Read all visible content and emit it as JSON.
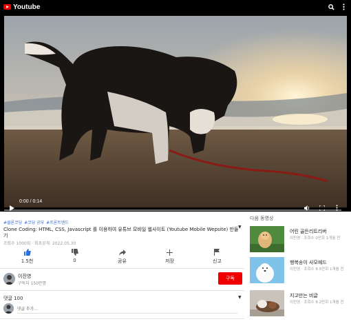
{
  "header": {
    "logo_text": "Youtube",
    "icons": [
      "search-icon",
      "more-vertical-icon"
    ]
  },
  "player": {
    "time": "0:00 / 0:14",
    "progress": 0,
    "controls": [
      "play-icon",
      "volume-icon",
      "fullscreen-icon",
      "more-vertical-icon"
    ]
  },
  "video": {
    "hashtags": [
      "#클론코딩",
      "#코딩 공부",
      "#프론트엔드"
    ],
    "title": "Clone Coding: HTML, CSS, Javascript 를 이용하여 유튜브 모바일 웹사이트 (Youtube Mobile Wepsite) 만들기",
    "meta": "조회수 1000회 · 최초공개: 2022.05.30"
  },
  "actions": [
    {
      "icon": "thumbs-up-icon",
      "label": "1.5천"
    },
    {
      "icon": "thumbs-down-icon",
      "label": "0"
    },
    {
      "icon": "share-icon",
      "label": "공유"
    },
    {
      "icon": "plus-icon",
      "label": "저장"
    },
    {
      "icon": "flag-icon",
      "label": "신고"
    }
  ],
  "channel": {
    "name": "이진영",
    "subscribers": "구독자 150만명",
    "subscribe_label": "구독"
  },
  "comments": {
    "header": "댓글 100",
    "placeholder": "댓글 추가..."
  },
  "sidebar": {
    "heading": "다음 동영상",
    "items": [
      {
        "title": "어린 골든리트리버",
        "meta": "이진영 · 조회수 0만회 1개월 전"
      },
      {
        "title": "행복송이 사모예드",
        "meta": "이진영 · 조회수 8.5만회 1개월 전"
      },
      {
        "title": "지고만는 비글",
        "meta": "이진영 · 조회수 8.2만회 1개월 전"
      }
    ]
  },
  "colors": {
    "accent": "#ee0000",
    "hashtag": "#3a6bd6",
    "action_icon": "#2a6fd6"
  }
}
